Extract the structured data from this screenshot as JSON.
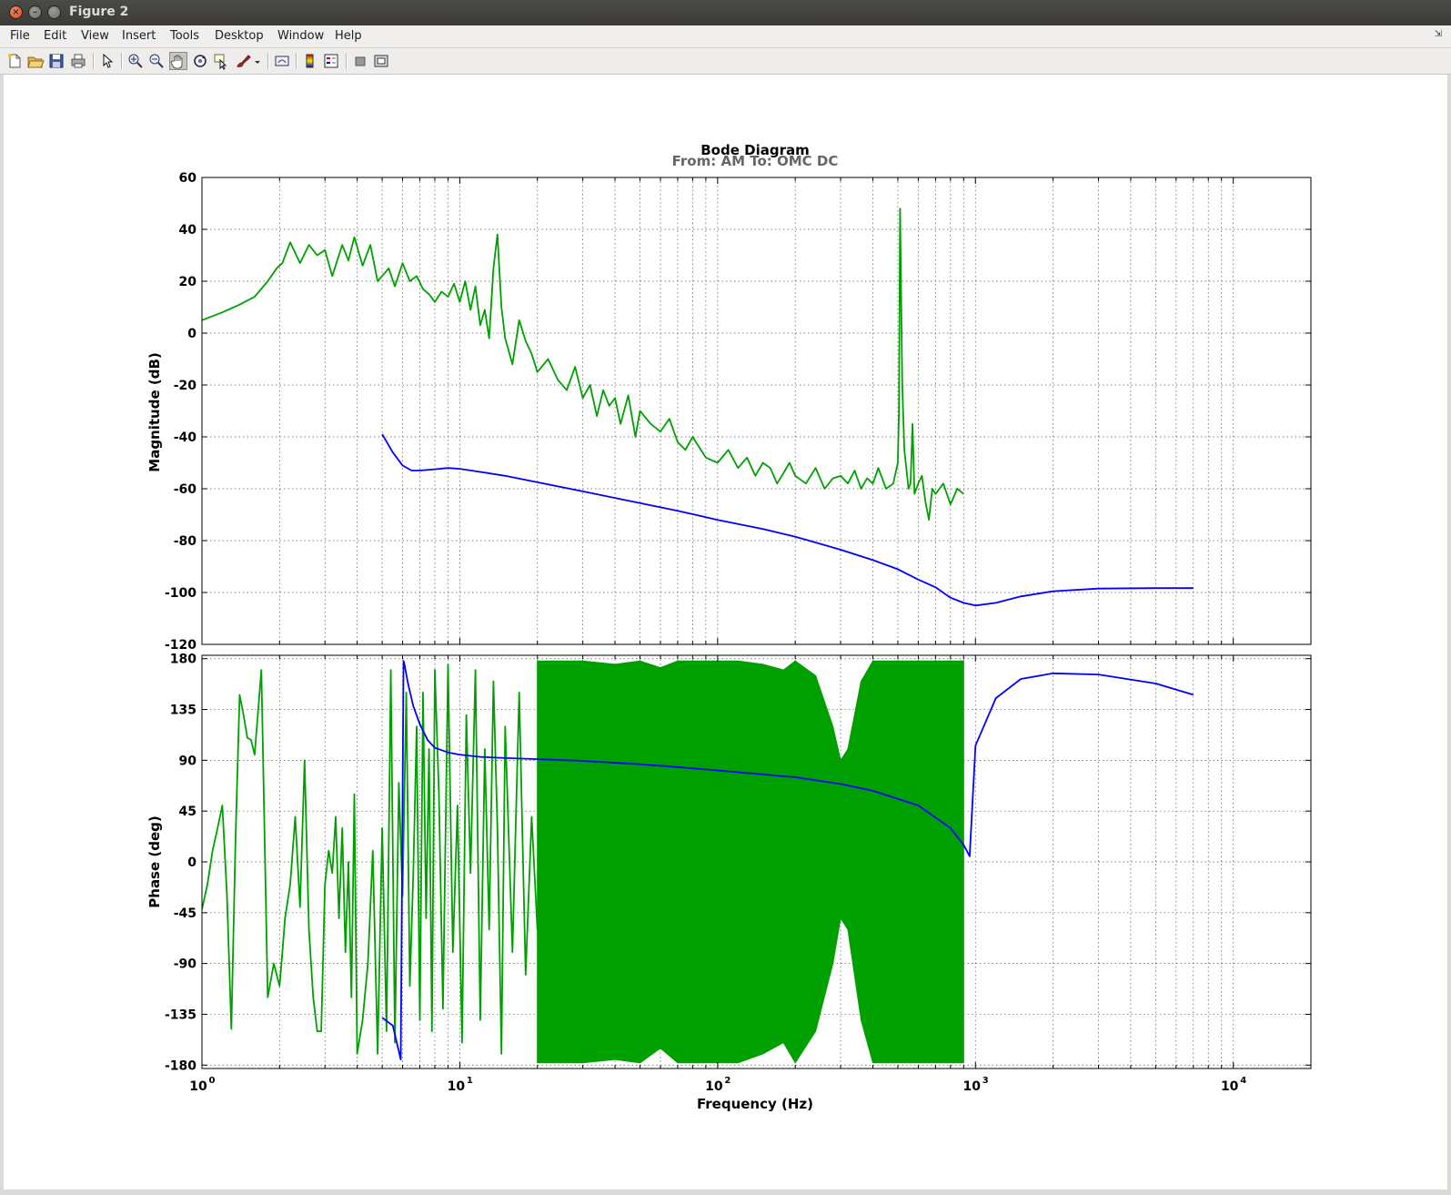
{
  "window": {
    "title": "Figure 2"
  },
  "menu": [
    "File",
    "Edit",
    "View",
    "Insert",
    "Tools",
    "Desktop",
    "Window",
    "Help"
  ],
  "toolbar": [
    "new-figure-icon",
    "open-icon",
    "save-icon",
    "print-icon",
    "edit-plot-arrow-icon",
    "zoom-in-icon",
    "zoom-out-icon",
    "pan-hand-icon",
    "rotate-3d-icon",
    "data-cursor-icon",
    "brush-icon",
    "link-plot-icon",
    "colorbar-icon",
    "legend-icon",
    "hide-plot-tools-icon",
    "show-plot-tools-icon"
  ],
  "colors": {
    "measured": "#00a000",
    "model": "#0000ff",
    "window_bar": "#3c3b37",
    "close_button": "#dd4814"
  },
  "chart_data": {
    "type": "line",
    "title": "Bode Diagram",
    "subtitle": "From: AM  To: OMC DC",
    "xlabel": "Frequency  (Hz)",
    "x_scale": "log",
    "xlim": [
      1,
      20000
    ],
    "x_ticks": [
      1,
      10,
      100,
      1000,
      10000
    ],
    "x_tick_labels": [
      {
        "base": "10",
        "exp": "0"
      },
      {
        "base": "10",
        "exp": "1"
      },
      {
        "base": "10",
        "exp": "2"
      },
      {
        "base": "10",
        "exp": "3"
      },
      {
        "base": "10",
        "exp": "4"
      }
    ],
    "grid": true,
    "panels": [
      {
        "name": "magnitude",
        "ylabel": "Magnitude (dB)",
        "ylim": [
          -120,
          60
        ],
        "y_ticks": [
          60,
          40,
          20,
          0,
          -20,
          -40,
          -60,
          -80,
          -100,
          -120
        ],
        "series": [
          {
            "color": "#00a000",
            "x": [
              1,
              1.2,
              1.4,
              1.6,
              1.8,
              1.95,
              2.05,
              2.2,
              2.4,
              2.6,
              2.8,
              3.0,
              3.2,
              3.5,
              3.7,
              3.9,
              4.2,
              4.5,
              4.8,
              5.0,
              5.3,
              5.6,
              6.0,
              6.4,
              6.8,
              7.2,
              7.6,
              8.0,
              8.5,
              9.0,
              9.5,
              10,
              10.5,
              11,
              11.5,
              12,
              12.5,
              13,
              13.5,
              14,
              14.5,
              15,
              16,
              17,
              18,
              19,
              20,
              22,
              24,
              26,
              28,
              30,
              32,
              34,
              36,
              38,
              40,
              42,
              45,
              48,
              50,
              55,
              60,
              65,
              70,
              75,
              80,
              90,
              100,
              110,
              120,
              130,
              140,
              150,
              160,
              170,
              180,
              190,
              200,
              220,
              240,
              260,
              280,
              300,
              320,
              340,
              360,
              380,
              400,
              420,
              450,
              480,
              500,
              505,
              510,
              520,
              530,
              550,
              560,
              570,
              580,
              600,
              620,
              640,
              660,
              680,
              700,
              750,
              800,
              850,
              900
            ],
            "y": [
              5,
              8,
              11,
              14,
              20,
              25,
              27,
              35,
              27,
              34,
              30,
              32,
              22,
              34,
              28,
              37,
              26,
              34,
              20,
              22,
              25,
              18,
              27,
              20,
              22,
              17,
              15,
              12,
              16,
              14,
              19,
              12,
              20,
              9,
              18,
              3,
              9,
              -2,
              25,
              38,
              10,
              -2,
              -12,
              5,
              -3,
              -8,
              -15,
              -10,
              -18,
              -22,
              -13,
              -25,
              -20,
              -32,
              -22,
              -28,
              -25,
              -35,
              -24,
              -40,
              -30,
              -35,
              -38,
              -33,
              -42,
              -45,
              -40,
              -48,
              -50,
              -45,
              -52,
              -48,
              -55,
              -50,
              -52,
              -58,
              -54,
              -50,
              -55,
              -58,
              -52,
              -60,
              -56,
              -55,
              -58,
              -53,
              -60,
              -56,
              -58,
              -52,
              -60,
              -58,
              -50,
              -30,
              48,
              -20,
              -45,
              -60,
              -58,
              -35,
              -62,
              -58,
              -55,
              -65,
              -72,
              -60,
              -62,
              -58,
              -66,
              -60,
              -62
            ]
          },
          {
            "color": "#0000ff",
            "x": [
              5,
              5.5,
              6,
              6.5,
              7,
              8,
              9,
              10,
              12,
              15,
              20,
              30,
              50,
              70,
              100,
              150,
              200,
              300,
              400,
              500,
              600,
              700,
              800,
              900,
              1000,
              1200,
              1500,
              2000,
              3000,
              5000,
              7000
            ],
            "y": [
              -39,
              -46,
              -51,
              -53,
              -53,
              -52.5,
              -52,
              -52.3,
              -53.5,
              -55,
              -57.5,
              -61,
              -65.5,
              -68.5,
              -72,
              -75.5,
              -78.5,
              -83.5,
              -87.5,
              -91,
              -95,
              -98,
              -102,
              -104,
              -105,
              -104,
              -101.5,
              -99.5,
              -98.5,
              -98.3,
              -98.3
            ]
          }
        ]
      },
      {
        "name": "phase",
        "ylabel": "Phase (deg)",
        "ylim": [
          -183,
          183
        ],
        "y_ticks": [
          180,
          135,
          90,
          45,
          0,
          -45,
          -90,
          -135,
          -180
        ],
        "series": [
          {
            "color": "#00a000",
            "x": [
              1,
              1.05,
              1.1,
              1.15,
              1.2,
              1.25,
              1.3,
              1.35,
              1.4,
              1.45,
              1.5,
              1.55,
              1.6,
              1.7,
              1.8,
              1.9,
              2.0,
              2.05,
              2.1,
              2.2,
              2.3,
              2.4,
              2.5,
              2.6,
              2.7,
              2.8,
              2.9,
              3.0,
              3.1,
              3.2,
              3.3,
              3.4,
              3.5,
              3.6,
              3.7,
              3.8,
              3.9,
              4.0,
              4.2,
              4.4,
              4.6,
              4.8,
              5.0,
              5.2,
              5.4,
              5.6,
              5.8,
              6.0,
              6.2,
              6.4,
              6.6,
              6.8,
              7.0,
              7.2,
              7.4,
              7.6,
              7.8,
              8.0,
              8.3,
              8.6,
              9.0,
              9.4,
              9.8,
              10.2,
              10.6,
              11,
              11.5,
              12,
              12.5,
              13,
              13.5,
              14,
              14.5,
              15,
              16,
              17,
              18,
              19,
              20,
              21,
              22,
              23,
              24,
              25
            ],
            "y": [
              -42,
              -20,
              10,
              30,
              50,
              -30,
              -148,
              20,
              148,
              130,
              110,
              108,
              95,
              170,
              -120,
              -90,
              -110,
              -80,
              -50,
              -20,
              40,
              -40,
              90,
              -60,
              -120,
              -150,
              -150,
              -20,
              10,
              -10,
              40,
              -50,
              30,
              -80,
              0,
              -120,
              60,
              -170,
              -140,
              -90,
              10,
              -170,
              30,
              -150,
              170,
              -160,
              70,
              -30,
              150,
              -110,
              -10,
              120,
              -140,
              150,
              -50,
              100,
              -150,
              170,
              60,
              -130,
              175,
              -80,
              50,
              -160,
              130,
              -10,
              170,
              -140,
              100,
              -60,
              160,
              30,
              -170,
              120,
              -80,
              150,
              -100,
              40,
              -60,
              170,
              -150,
              90,
              -30,
              160
            ]
          },
          {
            "color": "#00a000",
            "fill": true,
            "x": [
              20,
              25,
              30,
              40,
              50,
              60,
              70,
              80,
              100,
              120,
              150,
              180,
              200,
              240,
              280,
              300,
              320,
              360,
              400,
              450,
              500,
              550,
              600,
              700,
              800,
              900
            ],
            "y_high": [
              178,
              178,
              178,
              175,
              178,
              172,
              178,
              178,
              178,
              178,
              175,
              170,
              178,
              165,
              120,
              90,
              100,
              160,
              178,
              178,
              178,
              178,
              178,
              178,
              178,
              178
            ],
            "y_low": [
              -178,
              -178,
              -178,
              -175,
              -178,
              -165,
              -178,
              -178,
              -178,
              -178,
              -170,
              -160,
              -178,
              -150,
              -90,
              -50,
              -60,
              -140,
              -178,
              -178,
              -178,
              -178,
              -178,
              -178,
              -178,
              -178
            ]
          },
          {
            "color": "#0000ff",
            "x": [
              5,
              5.5,
              5.9,
              6.05,
              6.1,
              6.3,
              6.6,
              7.0,
              7.5,
              8,
              9,
              10,
              12,
              15,
              20,
              30,
              50,
              70,
              100,
              150,
              200,
              300,
              400,
              600,
              800,
              900,
              950,
              1000,
              1200,
              1500,
              2000,
              3000,
              5000,
              7000
            ],
            "y": [
              -138,
              -145,
              -175,
              178,
              175,
              158,
              138,
              122,
              108,
              101,
              97,
              95,
              93,
              92,
              91,
              89.5,
              86.5,
              84,
              81,
              77.5,
              75,
              69,
              63,
              50,
              30,
              15,
              5,
              103,
              145,
              162,
              167,
              166,
              158,
              148
            ]
          }
        ]
      }
    ]
  }
}
